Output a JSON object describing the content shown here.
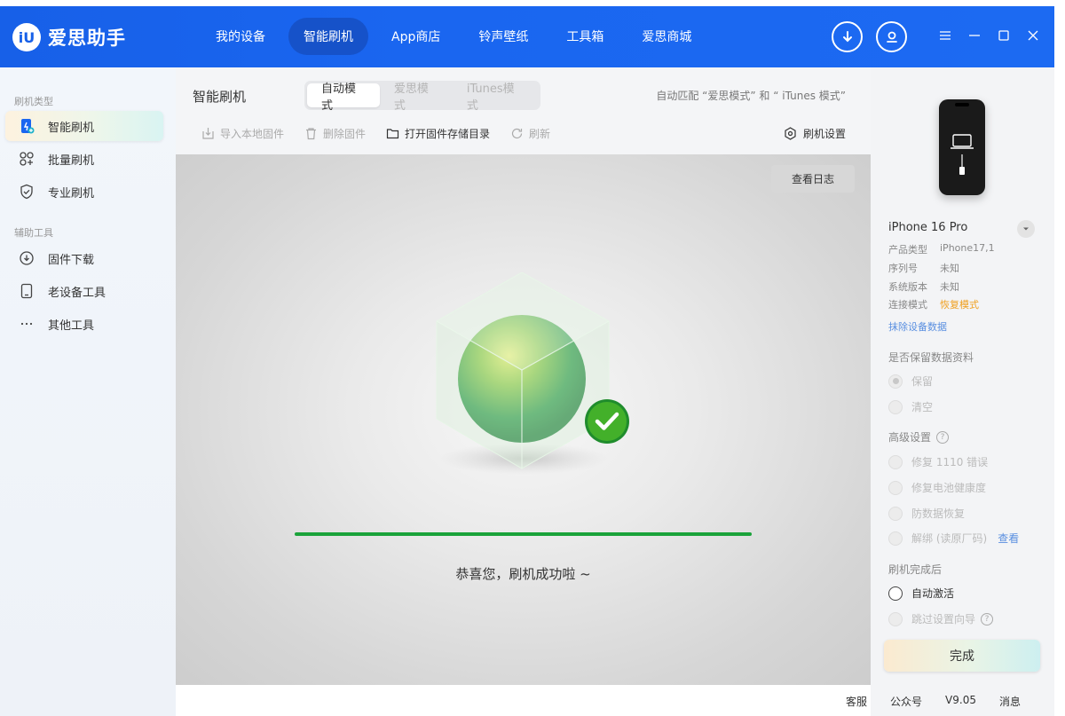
{
  "app": {
    "logo_mark": "iU",
    "name": "爱思助手"
  },
  "nav": [
    {
      "label": "我的设备"
    },
    {
      "label": "智能刷机",
      "active": true
    },
    {
      "label": "App商店"
    },
    {
      "label": "铃声壁纸"
    },
    {
      "label": "工具箱"
    },
    {
      "label": "爱思商城"
    }
  ],
  "sidebar": {
    "section1": "刷机类型",
    "items1": [
      {
        "label": "智能刷机",
        "icon": "phone-flash-icon",
        "active": true
      },
      {
        "label": "批量刷机",
        "icon": "grid-icon"
      },
      {
        "label": "专业刷机",
        "icon": "shield-icon"
      }
    ],
    "section2": "辅助工具",
    "items2": [
      {
        "label": "固件下载",
        "icon": "download-icon"
      },
      {
        "label": "老设备工具",
        "icon": "tablet-icon"
      },
      {
        "label": "其他工具",
        "icon": "more-icon"
      }
    ]
  },
  "main": {
    "title": "智能刷机",
    "tabs": [
      {
        "label": "自动模式",
        "active": true
      },
      {
        "label": "爱思模式"
      },
      {
        "label": "iTunes模式"
      }
    ],
    "auto_match": "自动匹配 “爱思模式” 和 “ iTunes 模式”",
    "toolbar": {
      "import": "导入本地固件",
      "delete": "删除固件",
      "open_dir": "打开固件存储目录",
      "refresh": "刷新",
      "settings": "刷机设置"
    },
    "view_log": "查看日志",
    "progress": 1.0,
    "success": "恭喜您，刷机成功啦 ~"
  },
  "device": {
    "name": "iPhone 16 Pro",
    "info": [
      {
        "key": "产品类型",
        "value": "iPhone17,1"
      },
      {
        "key": "序列号",
        "value": "未知"
      },
      {
        "key": "系统版本",
        "value": "未知"
      },
      {
        "key": "连接模式",
        "value": "恢复模式",
        "highlight": true
      }
    ],
    "wipe_link": "抹除设备数据",
    "keep_data_title": "是否保留数据资料",
    "keep": "保留",
    "clear": "清空",
    "advanced_title": "高级设置",
    "advanced": [
      "修复 1110 错误",
      "修复电池健康度",
      "防数据恢复",
      "解绑 (读原厂码)"
    ],
    "view": "查看",
    "after_title": "刷机完成后",
    "auto_activate": "自动激活",
    "skip_setup": "跳过设置向导",
    "done": "完成"
  },
  "footer": {
    "service": "客服",
    "wechat": "公众号",
    "version": "V9.05",
    "message": "消息"
  },
  "colors": {
    "nav_blue": "#1a66f0",
    "success_green": "#1aa33a",
    "link_blue": "#5a8fe0",
    "recovery_orange": "#f0a020"
  }
}
